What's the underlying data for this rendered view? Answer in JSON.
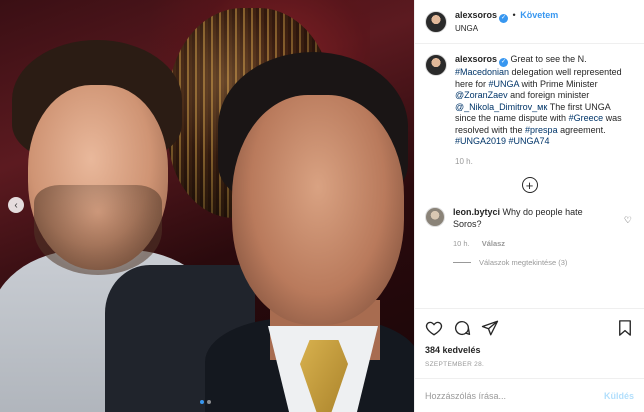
{
  "header": {
    "username": "alexsoros",
    "separator": "•",
    "follow_label": "Követem",
    "location": "UNGA"
  },
  "caption": {
    "username": "alexsoros",
    "parts": {
      "t1": "Great to see the N. ",
      "h1": "#Macedonian",
      "t2": " delegation well represented here for ",
      "h2": "#UNGA",
      "t3": " with Prime Minister ",
      "m1": "@ZoranZaev",
      "t4": " and foreign minister ",
      "m2": "@_Nikola_Dimitrov_мк",
      "t5": " The first UNGA since the name dispute with ",
      "h3": "#Greece",
      "t6": " was resolved with the ",
      "h4": "#prespa",
      "t7": " agreement. ",
      "h5": "#UNGA2019",
      "t8": " ",
      "h6": "#UNGA74"
    },
    "time": "10 h."
  },
  "load_more": "+",
  "comment": {
    "username": "leon.bytyci",
    "text": "Why do people hate Soros?",
    "time": "10 h.",
    "reply_label": "Válasz",
    "view_replies": "Válaszok megtekintése (3)"
  },
  "likes": "384 kedvelés",
  "date": "SZEPTEMBER 28.",
  "comment_form": {
    "placeholder": "Hozzászólás írása...",
    "post_label": "Küldés"
  },
  "icons": {
    "verified": "verified-badge-icon",
    "heart": "heart-icon",
    "comment": "comment-icon",
    "share": "share-icon",
    "bookmark": "bookmark-icon",
    "nav": "chevron-left-icon"
  },
  "colors": {
    "accent": "#3897f0",
    "link": "#003569",
    "muted": "#999999",
    "post_disabled": "#b2dffc"
  },
  "carousel": {
    "prev_glyph": "‹",
    "dots_total": 2,
    "active_dot": 1
  }
}
